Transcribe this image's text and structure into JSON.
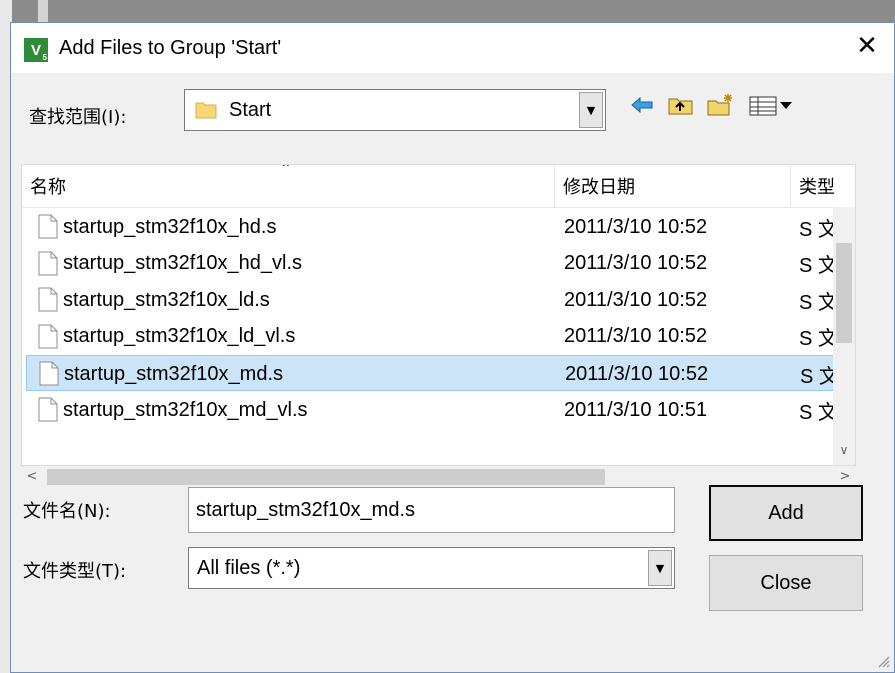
{
  "dialog": {
    "title": "Add Files to Group 'Start'",
    "app_icon": "keil-uvision-icon",
    "close_glyph": "✕"
  },
  "look_in": {
    "label": "查找范围(I):",
    "value": "Start",
    "toolbar_icons": [
      "back-arrow-icon",
      "up-folder-icon",
      "new-folder-icon",
      "view-menu-icon"
    ]
  },
  "list": {
    "columns": [
      "名称",
      "修改日期",
      "类型"
    ],
    "rows": [
      {
        "name": "startup_stm32f10x_hd.s",
        "date": "2011/3/10 10:52",
        "type": "S 文"
      },
      {
        "name": "startup_stm32f10x_hd_vl.s",
        "date": "2011/3/10 10:52",
        "type": "S 文"
      },
      {
        "name": "startup_stm32f10x_ld.s",
        "date": "2011/3/10 10:52",
        "type": "S 文"
      },
      {
        "name": "startup_stm32f10x_ld_vl.s",
        "date": "2011/3/10 10:52",
        "type": "S 文"
      },
      {
        "name": "startup_stm32f10x_md.s",
        "date": "2011/3/10 10:52",
        "type": "S 文",
        "selected": true
      },
      {
        "name": "startup_stm32f10x_md_vl.s",
        "date": "2011/3/10 10:51",
        "type": "S 文"
      }
    ]
  },
  "file_name": {
    "label": "文件名(N):",
    "value": "startup_stm32f10x_md.s"
  },
  "file_type": {
    "label": "文件类型(T):",
    "value": "All files (*.*)"
  },
  "buttons": {
    "add": "Add",
    "close": "Close"
  },
  "colors": {
    "selection_bg": "#cce4f7",
    "selection_border": "#99c9ef",
    "dialog_bg": "#f0f0f0"
  }
}
